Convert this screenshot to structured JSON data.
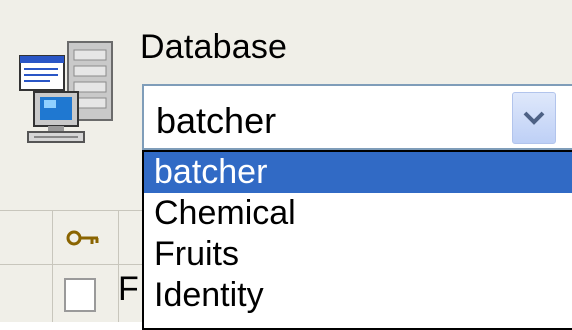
{
  "database": {
    "label": "Database",
    "selected_value": "batcher",
    "icon": "computer-database-icon",
    "options": [
      "batcher",
      "Chemical",
      "Fruits",
      "Identity"
    ],
    "selected_index": 0
  },
  "grid": {
    "header_icon": "key-icon",
    "row_partial_text": "F"
  },
  "colors": {
    "selection": "#316ac5",
    "combo_border": "#7f9db9",
    "panel": "#f0efe8"
  }
}
